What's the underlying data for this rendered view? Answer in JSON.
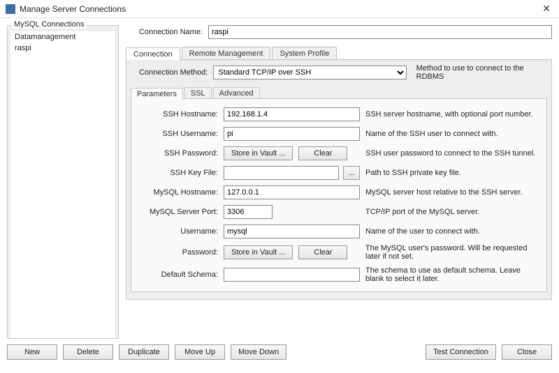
{
  "title": "Manage Server Connections",
  "sidebar": {
    "header": "MySQL Connections",
    "items": [
      "Datamanagement",
      "raspi"
    ]
  },
  "connection_name": {
    "label": "Connection Name:",
    "value": "raspi"
  },
  "tabs": [
    "Connection",
    "Remote Management",
    "System Profile"
  ],
  "method": {
    "label": "Connection Method:",
    "value": "Standard TCP/IP over SSH",
    "hint": "Method to use to connect to the RDBMS"
  },
  "subtabs": [
    "Parameters",
    "SSL",
    "Advanced"
  ],
  "fields": {
    "ssh_host": {
      "label": "SSH Hostname:",
      "value": "192.168.1.4",
      "hint": "SSH server hostname, with optional port number."
    },
    "ssh_user": {
      "label": "SSH Username:",
      "value": "pi",
      "hint": "Name of the SSH user to connect with."
    },
    "ssh_pass": {
      "label": "SSH Password:",
      "store": "Store in Vault ...",
      "clear": "Clear",
      "hint": "SSH user password to connect to the SSH tunnel."
    },
    "ssh_key": {
      "label": "SSH Key File:",
      "value": "",
      "hint": "Path to SSH private key file."
    },
    "my_host": {
      "label": "MySQL Hostname:",
      "value": "127.0.0.1",
      "hint": "MySQL server host relative to the SSH server."
    },
    "my_port": {
      "label": "MySQL Server Port:",
      "value": "3306",
      "hint": "TCP/IP port of the MySQL server."
    },
    "my_user": {
      "label": "Username:",
      "value": "mysql",
      "hint": "Name of the user to connect with."
    },
    "my_pass": {
      "label": "Password:",
      "store": "Store in Vault ...",
      "clear": "Clear",
      "hint": "The MySQL user's password. Will be requested later if not set."
    },
    "schema": {
      "label": "Default Schema:",
      "value": "",
      "hint": "The schema to use as default schema. Leave blank to select it later."
    }
  },
  "footer": {
    "new": "New",
    "delete": "Delete",
    "duplicate": "Duplicate",
    "move_up": "Move Up",
    "move_down": "Move Down",
    "test": "Test Connection",
    "close": "Close"
  },
  "browse": "..."
}
